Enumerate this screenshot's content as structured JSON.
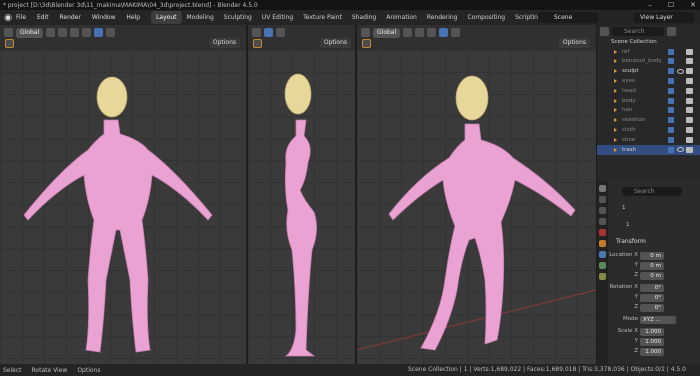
{
  "window": {
    "title": "* project [D:\\3d\\Blender 3d\\11_makima\\MAKIMA\\04_3d\\project.blend] - Blender 4.5.0",
    "min": "–",
    "max": "☐",
    "close": "✕"
  },
  "menu": [
    "File",
    "Edit",
    "Render",
    "Window",
    "Help"
  ],
  "workspaces": [
    "Layout",
    "Modeling",
    "Sculpting",
    "UV Editing",
    "Texture Paint",
    "Shading",
    "Animation",
    "Rendering",
    "Compositing",
    "Scripting"
  ],
  "scene": {
    "label": "Scene",
    "view_layer": "View Layer"
  },
  "viewports": [
    {
      "orientation": "Global",
      "options": "Options"
    },
    {
      "orientation": "Global",
      "options": "Options"
    },
    {
      "orientation": "Global",
      "options": "Options"
    }
  ],
  "outliner": {
    "search_placeholder": "Search",
    "collection": "Scene Collection",
    "items": [
      {
        "name": "ref",
        "dim": true,
        "selected": false
      },
      {
        "name": "blockout_body",
        "dim": true,
        "selected": false
      },
      {
        "name": "sculpt",
        "dim": false,
        "selected": false
      },
      {
        "name": "eyes",
        "dim": true,
        "selected": false
      },
      {
        "name": "head",
        "dim": true,
        "selected": false
      },
      {
        "name": "body",
        "dim": true,
        "selected": false
      },
      {
        "name": "hair",
        "dim": true,
        "selected": false
      },
      {
        "name": "skeleton",
        "dim": true,
        "selected": false
      },
      {
        "name": "cloth",
        "dim": true,
        "selected": false
      },
      {
        "name": "shoe",
        "dim": true,
        "selected": false
      },
      {
        "name": "trash",
        "dim": false,
        "selected": true
      }
    ]
  },
  "properties": {
    "search_placeholder": "Search",
    "object_name": "1",
    "data_name": "1",
    "panel_title": "Transform",
    "location_label": "Location X",
    "location": {
      "x": "0 m",
      "y": "0 m",
      "z": "0 m"
    },
    "rotation_label": "Rotation X",
    "rotation": {
      "x": "0°",
      "y": "0°",
      "z": "0°"
    },
    "mode_label": "Mode",
    "mode": "XYZ ...",
    "scale_label": "Scale X",
    "scale": {
      "x": "1.000",
      "y": "1.000",
      "z": "1.000"
    },
    "axis_y": "Y",
    "axis_z": "Z"
  },
  "statusbar": {
    "select": "Select",
    "rotate": "Rotate View",
    "options": "Options",
    "stats": "Scene Collection | 1 | Verts:1,689,022 | Faces:1,689,018 | Tris:3,378,036 | Objects:0/2 | 4.5.0"
  },
  "colors": {
    "accent": "#4772b3",
    "body": "#e9a2d2",
    "head": "#e8d79a"
  }
}
